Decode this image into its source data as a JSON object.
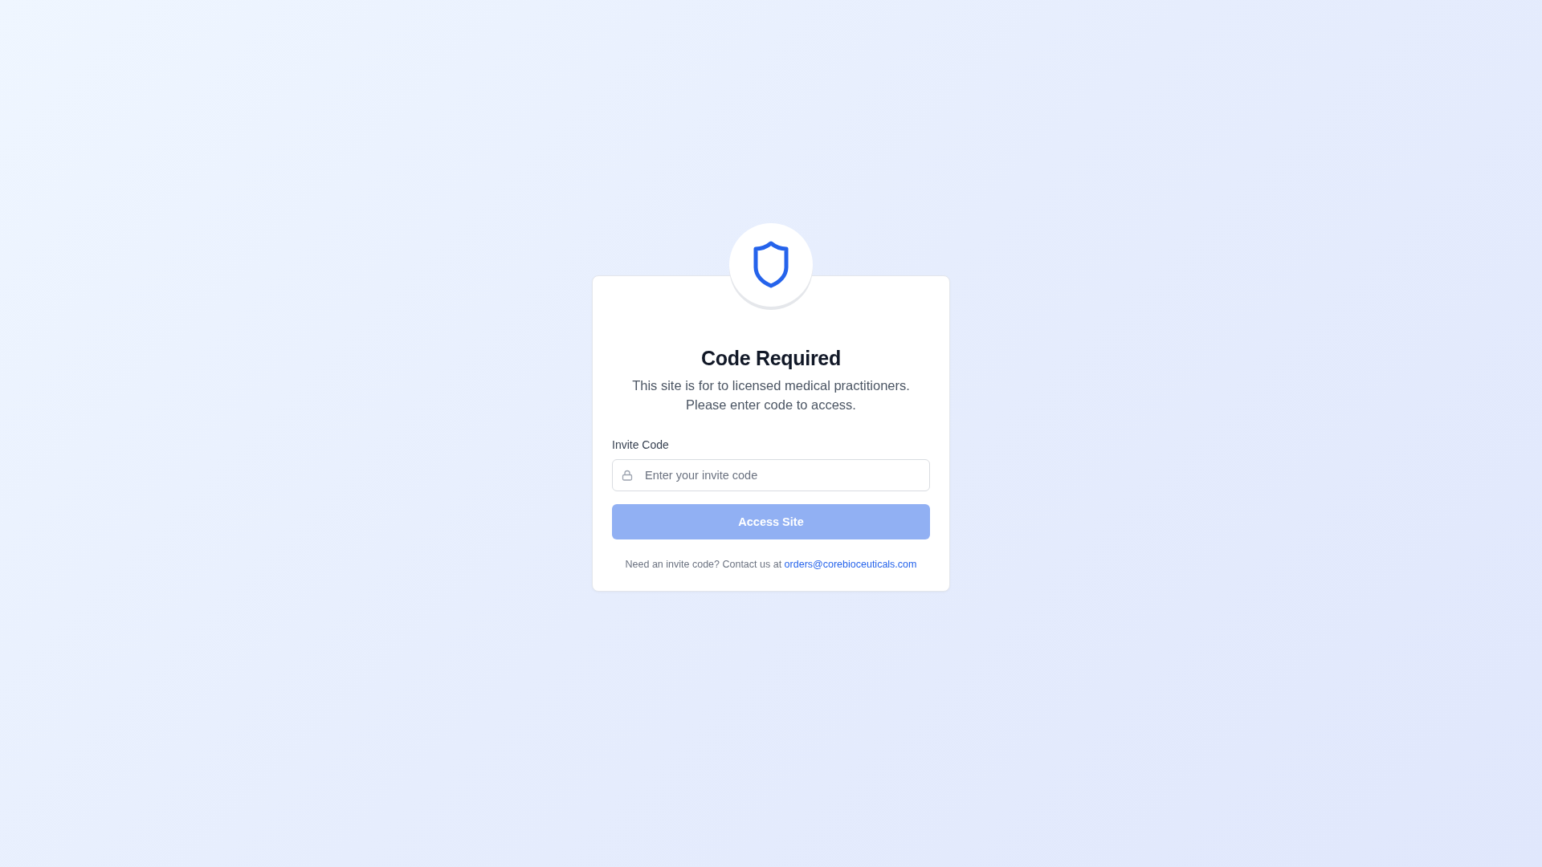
{
  "title": "Code Required",
  "description": [
    "This site is for to licensed medical practitioners.",
    "Please enter code to access."
  ],
  "field": {
    "label": "Invite Code",
    "placeholder": "Enter your invite code"
  },
  "button": {
    "label": "Access Site",
    "disabled": true
  },
  "footer": {
    "text": "Need an invite code? Contact us at",
    "link": "orders@corebioceuticals.com"
  }
}
